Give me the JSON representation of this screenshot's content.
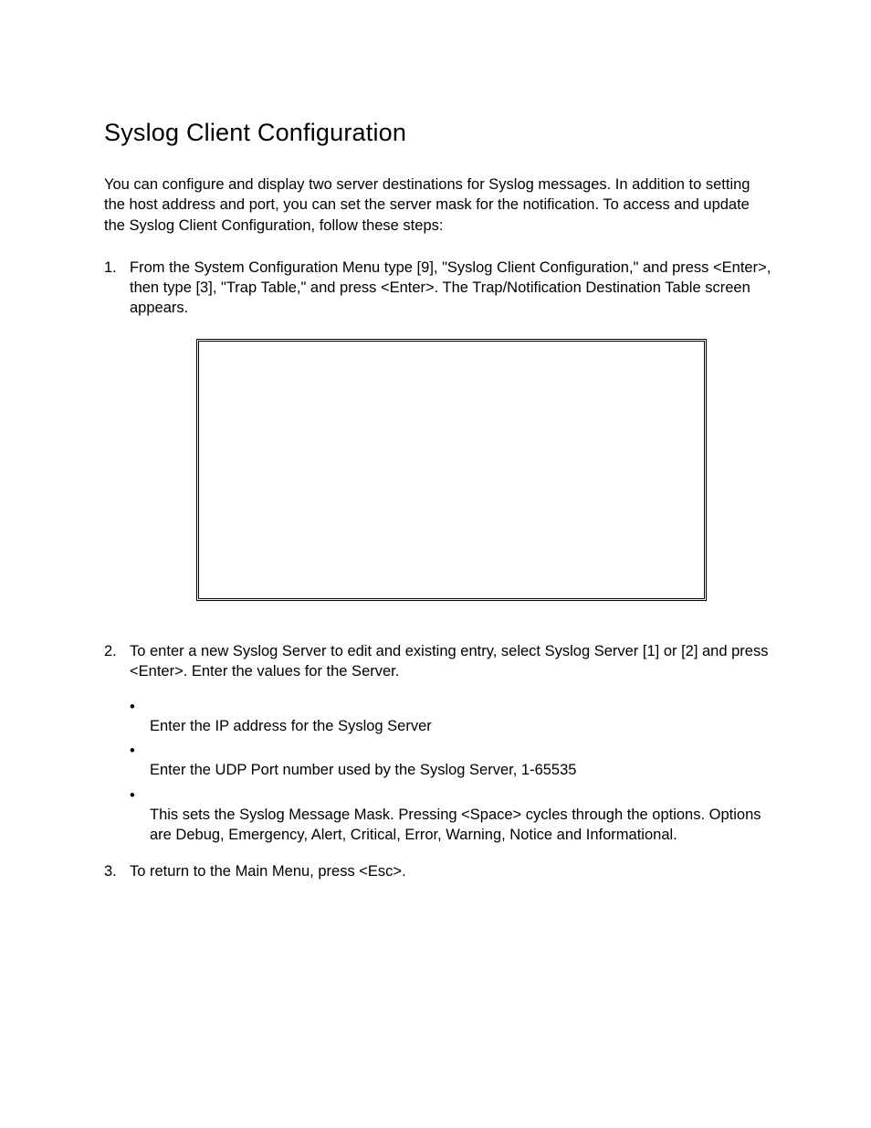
{
  "title": "Syslog Client Configuration",
  "intro": "You can configure and display two server destinations for Syslog messages.  In addition to setting the host address and port, you can set the server mask for the notification.  To access and update the Syslog Client Configuration, follow these steps:",
  "steps": {
    "s1": {
      "num": "1.",
      "text": "From the System Configuration Menu type [9], \"Syslog Client Configuration,\" and press <Enter>, then type [3], \"Trap Table,\" and press <Enter>.  The Trap/Notification Destination Table screen appears."
    },
    "s2": {
      "num": "2.",
      "text": "To enter a new Syslog Server to edit and existing entry, select Syslog Server [1] or [2] and press <Enter>.  Enter the values for the Server.",
      "bullets": {
        "b1": "Enter the IP address for the Syslog Server",
        "b2": "Enter the UDP Port number used by the Syslog Server, 1-65535",
        "b3": "This sets the Syslog Message Mask.  Pressing <Space> cycles through the options.  Options are Debug, Emergency, Alert, Critical, Error, Warning, Notice and Informational."
      }
    },
    "s3": {
      "num": "3.",
      "text": "To return to the Main Menu, press <Esc>."
    }
  },
  "bullet_glyph": "•"
}
